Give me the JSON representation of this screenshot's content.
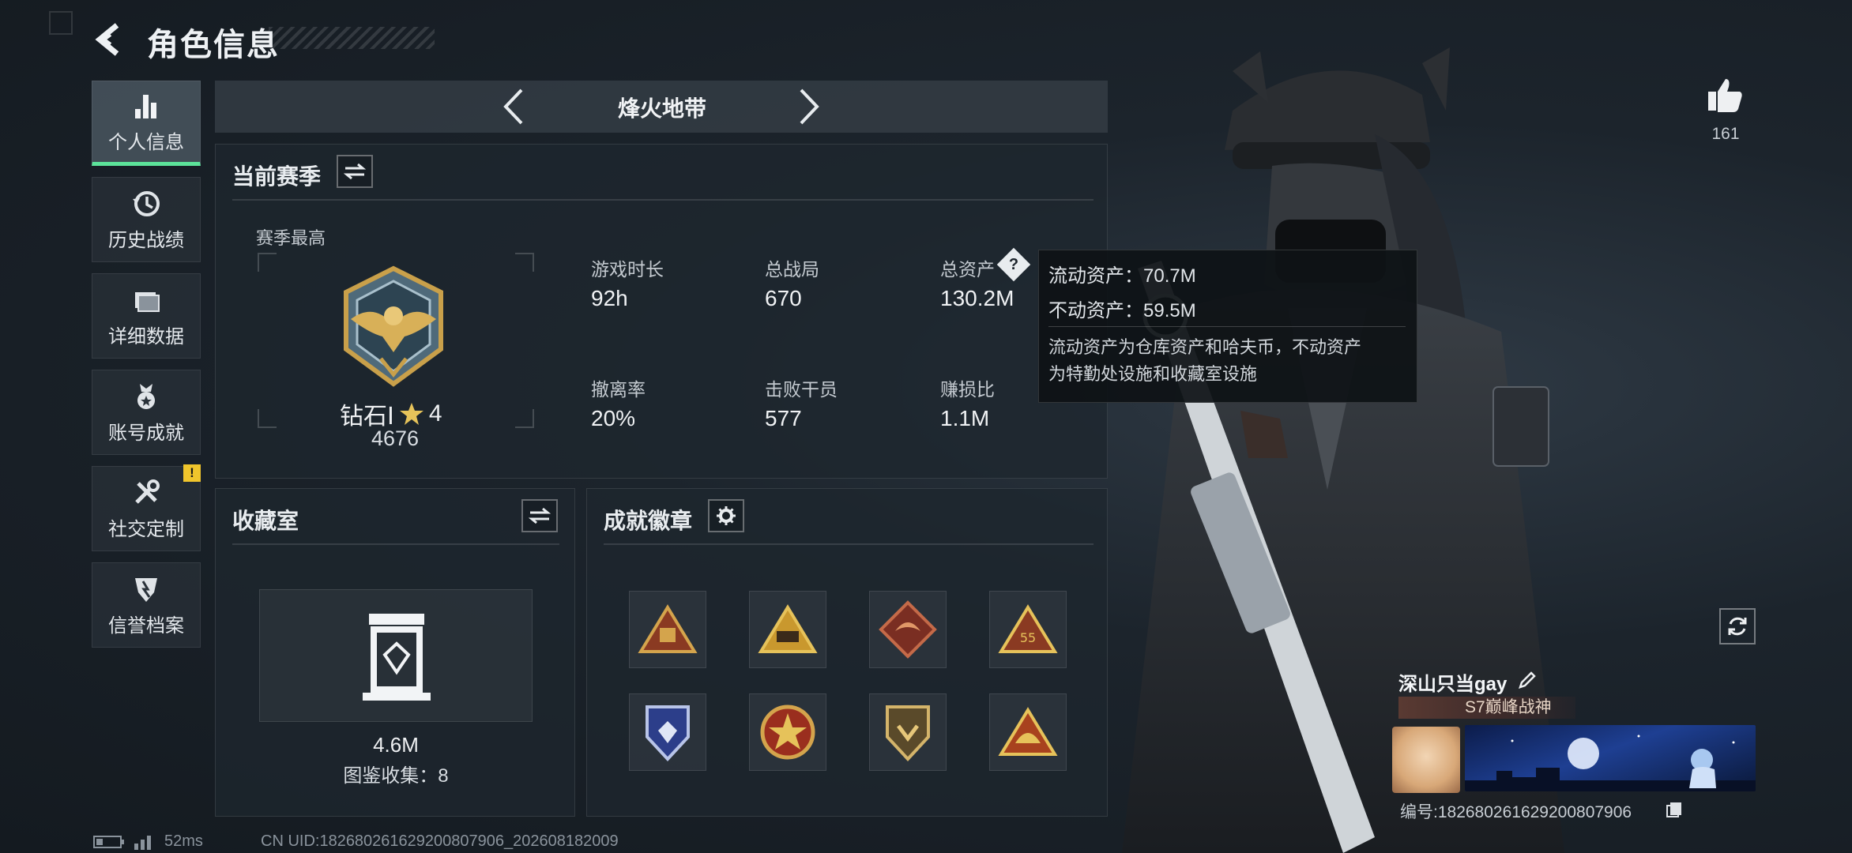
{
  "header": {
    "title": "角色信息"
  },
  "sidebar": {
    "items": [
      {
        "label": "个人信息",
        "icon": "bar-chart-icon"
      },
      {
        "label": "历史战绩",
        "icon": "history-icon"
      },
      {
        "label": "详细数据",
        "icon": "folder-icon"
      },
      {
        "label": "账号成就",
        "icon": "medal-icon"
      },
      {
        "label": "社交定制",
        "icon": "tools-icon"
      },
      {
        "label": "信誉档案",
        "icon": "shield-icon"
      }
    ],
    "alert": "!"
  },
  "mode": {
    "name": "烽火地带"
  },
  "season": {
    "title": "当前赛季",
    "best_label": "赛季最高",
    "rank": {
      "name": "钻石Ⅰ",
      "stars": "4",
      "score": "4676"
    },
    "stats": [
      {
        "label": "游戏时长",
        "value": "92h"
      },
      {
        "label": "总战局",
        "value": "670"
      },
      {
        "label": "总资产",
        "value": "130.2M"
      },
      {
        "label": "撤离率",
        "value": "20%"
      },
      {
        "label": "击败干员",
        "value": "577"
      },
      {
        "label": "赚损比",
        "value": "1.1M"
      }
    ]
  },
  "tooltip": {
    "liquid": "流动资产：70.7M",
    "fixed": "不动资产：59.5M",
    "desc_line1": "流动资产为仓库资产和哈夫币，不动资产",
    "desc_line2": "为特勤处设施和收藏室设施"
  },
  "collection": {
    "title": "收藏室",
    "value": "4.6M",
    "count_label": "图鉴收集：8"
  },
  "achievements": {
    "title": "成就徽章",
    "badges": [
      "triangle-gold-badge",
      "triangle-tank-badge",
      "dragon-diamond-badge",
      "triangle-55-badge",
      "blue-shield-badge",
      "star-emblem-badge",
      "shield-gold-badge",
      "triangle-helmet-badge"
    ]
  },
  "player": {
    "likes": "161",
    "name": "深山只当gay",
    "title": "S7巅峰战神",
    "id": "编号:1826802616292008079​06"
  },
  "footer": {
    "ping": "52ms",
    "uid": "CN UID:18268026162920080​7906_202608182009"
  },
  "colors": {
    "accent_green": "#5ce39a",
    "alert_yellow": "#f0c52c",
    "gold": "#c9a04a"
  }
}
